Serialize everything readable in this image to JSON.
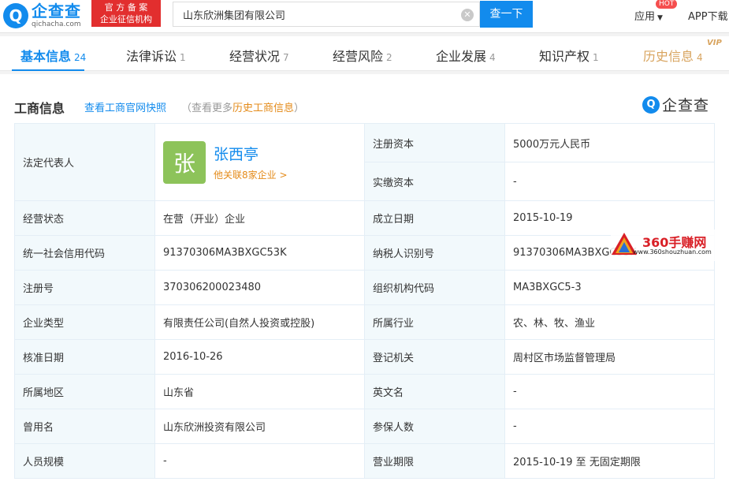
{
  "header": {
    "logo_cn": "企查查",
    "logo_en": "qichacha.com",
    "official_line1": "官 方 备 案",
    "official_line2": "企业征信机构",
    "search_value": "山东欣洲集团有限公司",
    "search_button": "查一下",
    "app_menu": "应用",
    "hot_badge": "HOT",
    "app_download": "APP下载"
  },
  "tabs": [
    {
      "label": "基本信息",
      "count": "24"
    },
    {
      "label": "法律诉讼",
      "count": "1"
    },
    {
      "label": "经营状况",
      "count": "7"
    },
    {
      "label": "经营风险",
      "count": "2"
    },
    {
      "label": "企业发展",
      "count": "4"
    },
    {
      "label": "知识产权",
      "count": "1"
    },
    {
      "label": "历史信息",
      "count": "4"
    }
  ],
  "vip_badge": "VIP",
  "section": {
    "title": "工商信息",
    "snapshot_link": "查看工商官网快照",
    "more_prefix": "（查看更多",
    "more_link": "历史工商信息",
    "more_suffix": "）",
    "brand_text": "企查查"
  },
  "rep": {
    "label": "法定代表人",
    "avatar_char": "张",
    "name": "张西亭",
    "related": "他关联8家企业 >"
  },
  "right_top": [
    {
      "label": "注册资本",
      "value": "5000万元人民币"
    },
    {
      "label": "实缴资本",
      "value": "-"
    }
  ],
  "rows": [
    {
      "l1": "经营状态",
      "v1": "在营（开业）企业",
      "l2": "成立日期",
      "v2": "2015-10-19"
    },
    {
      "l1": "统一社会信用代码",
      "v1": "91370306MA3BXGC53K",
      "l2": "纳税人识别号",
      "v2": "91370306MA3BXGC53K"
    },
    {
      "l1": "注册号",
      "v1": "370306200023480",
      "l2": "组织机构代码",
      "v2": "MA3BXGC5-3"
    },
    {
      "l1": "企业类型",
      "v1": "有限责任公司(自然人投资或控股)",
      "l2": "所属行业",
      "v2": "农、林、牧、渔业"
    },
    {
      "l1": "核准日期",
      "v1": "2016-10-26",
      "l2": "登记机关",
      "v2": "周村区市场监督管理局"
    },
    {
      "l1": "所属地区",
      "v1": "山东省",
      "l2": "英文名",
      "v2": "-"
    },
    {
      "l1": "曾用名",
      "v1": "山东欣洲投资有限公司",
      "l2": "参保人数",
      "v2": "-"
    },
    {
      "l1": "人员规模",
      "v1": "-",
      "l2": "营业期限",
      "v2": "2015-10-19 至 无固定期限"
    }
  ],
  "watermark": {
    "name": "360手赚网",
    "url": "www.360shouzhuan.com"
  },
  "colors": {
    "primary": "#128bed",
    "orange": "#e48b1a",
    "history": "#d8a45f",
    "official_red": "#e22e2e",
    "label_bg": "#f2f9fc"
  }
}
